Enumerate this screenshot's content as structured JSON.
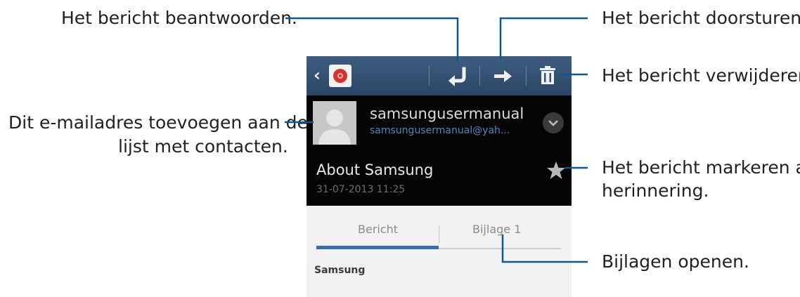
{
  "callouts": {
    "reply": "Het bericht beantwoorden.",
    "forward": "Het bericht doorsturen.",
    "delete": "Het bericht verwijderen.",
    "add_contact_line1": "Dit e-mailadres toevoegen aan de",
    "add_contact_line2": "lijst met contacten.",
    "mark_line1": "Het bericht markeren als",
    "mark_line2": "herinnering.",
    "attachments": "Bijlagen openen."
  },
  "phone": {
    "actionbar": {
      "back_icon": "chevron-left-icon",
      "app_icon": "email-app-icon",
      "actions": [
        "reply-icon",
        "forward-icon",
        "delete-icon"
      ]
    },
    "message": {
      "sender_name": "samsungusermanual",
      "sender_email": "samsungusermanual@yah...",
      "subject": "About Samsung",
      "date": "31-07-2013  11:25",
      "star_icon": "star-icon",
      "expand_icon": "chevron-down-icon"
    },
    "tabs": [
      {
        "label": "Bericht",
        "active": true
      },
      {
        "label": "Bijlage 1",
        "active": false
      }
    ],
    "body_text": "Samsung"
  },
  "colors": {
    "actionbar": "#34506f",
    "accent": "#3d6ea2",
    "callout_line": "#0a5a92"
  }
}
